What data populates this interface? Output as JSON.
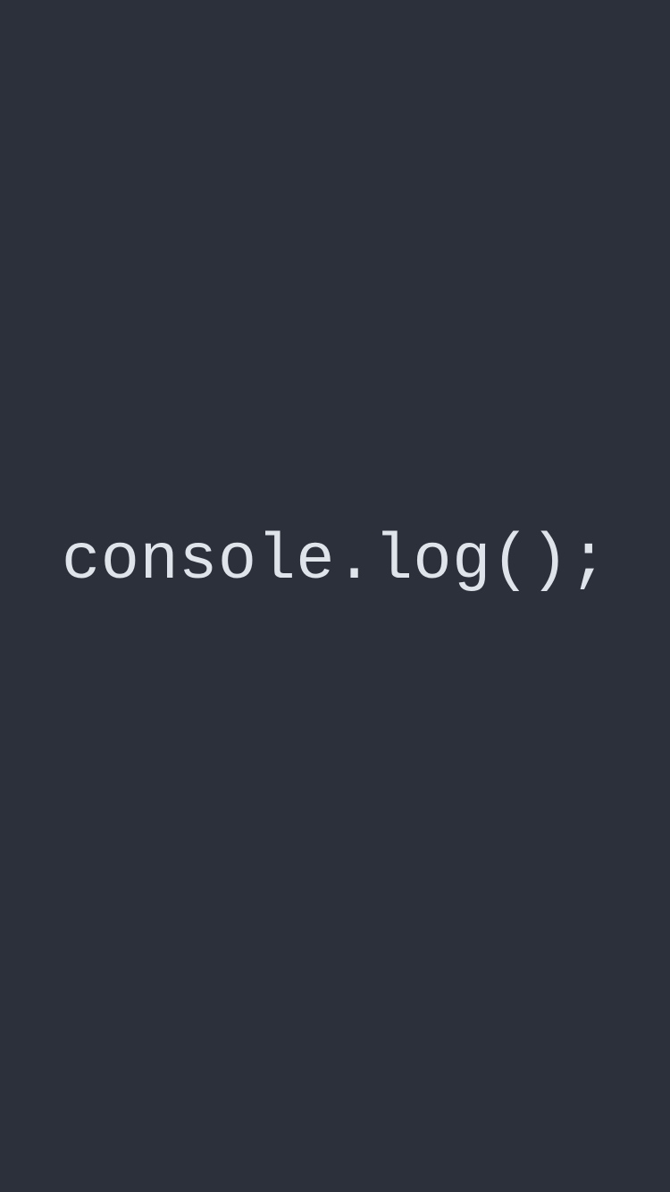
{
  "code": {
    "text": "console.log();"
  },
  "colors": {
    "background": "#2b303b",
    "text": "#dfe3ea"
  }
}
